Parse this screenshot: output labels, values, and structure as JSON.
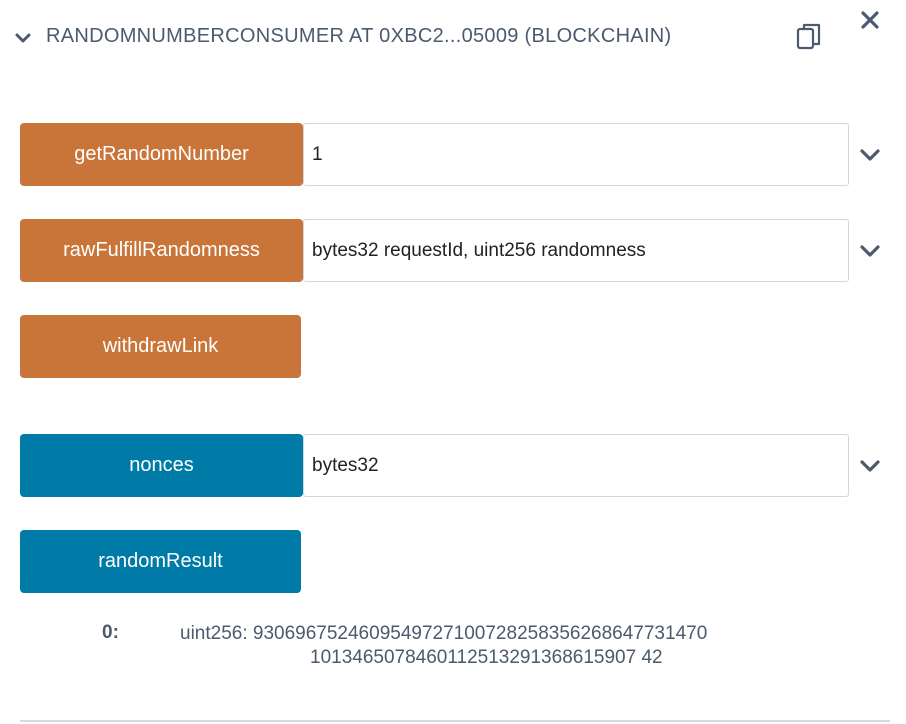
{
  "header": {
    "title": "RANDOMNUMBERCONSUMER AT 0XBC2...05009 (BLOCKCHAIN)",
    "collapse_icon": "chevron-down-icon",
    "copy_icon": "copy-icon",
    "close_icon": "close-icon"
  },
  "functions": [
    {
      "label": "getRandomNumber",
      "kind": "transact",
      "input_value": "1"
    },
    {
      "label": "rawFulfillRandomness",
      "kind": "transact",
      "input_value": "bytes32 requestId, uint256 randomness"
    },
    {
      "label": "withdrawLink",
      "kind": "transact"
    },
    {
      "label": "nonces",
      "kind": "call",
      "input_value": "bytes32"
    },
    {
      "label": "randomResult",
      "kind": "call"
    }
  ],
  "result": {
    "key": "0:",
    "value_line1": "uint256: 9306967524609549727100728258356268647731470",
    "value_line2": "1013465078460112513291368615907 42"
  },
  "colors": {
    "transact": "#c97539",
    "call": "#007aa6",
    "text": "#4b5a6e"
  }
}
